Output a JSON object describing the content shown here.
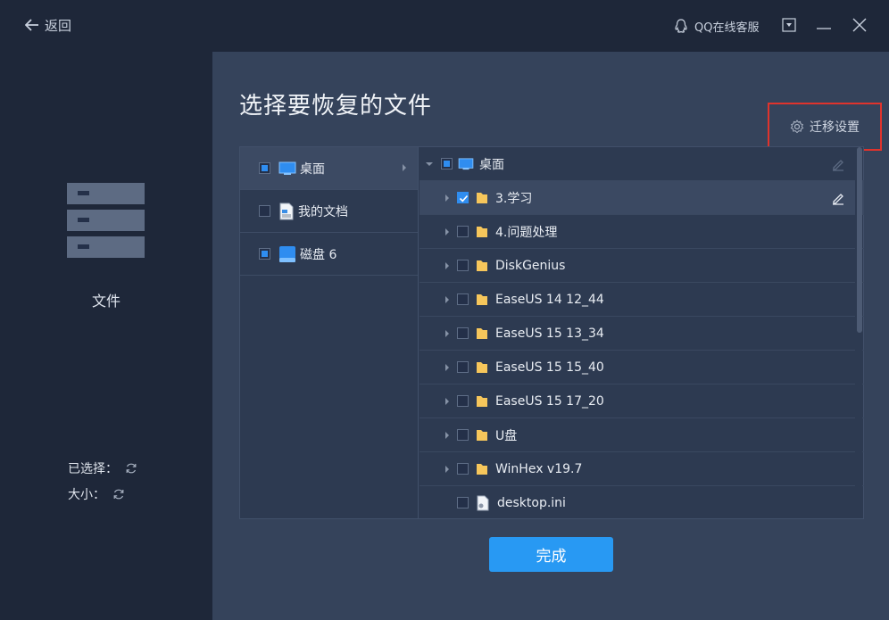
{
  "header": {
    "back_label": "返回",
    "support_label": "QQ在线客服"
  },
  "sidebar": {
    "label": "文件",
    "selected_label": "已选择：",
    "size_label": "大小："
  },
  "main": {
    "title": "选择要恢复的文件",
    "migrate_label": "迁移设置",
    "done_label": "完成"
  },
  "locations": [
    {
      "label": "桌面",
      "state": "partial",
      "icon": "desktop-icon"
    },
    {
      "label": "我的文档",
      "state": "unchecked",
      "icon": "document-icon"
    },
    {
      "label": "磁盘 6",
      "state": "partial",
      "icon": "disk-icon"
    }
  ],
  "tree": {
    "root": {
      "label": "桌面",
      "state": "partial",
      "icon": "desktop-icon"
    },
    "items": [
      {
        "label": "3.学习",
        "state": "checked",
        "icon": "folder-icon"
      },
      {
        "label": "4.问题处理",
        "state": "unchecked",
        "icon": "folder-icon"
      },
      {
        "label": "DiskGenius",
        "state": "unchecked",
        "icon": "folder-icon"
      },
      {
        "label": "EaseUS 14 12_44",
        "state": "unchecked",
        "icon": "folder-icon"
      },
      {
        "label": "EaseUS 15 13_34",
        "state": "unchecked",
        "icon": "folder-icon"
      },
      {
        "label": "EaseUS 15 15_40",
        "state": "unchecked",
        "icon": "folder-icon"
      },
      {
        "label": "EaseUS 15 17_20",
        "state": "unchecked",
        "icon": "folder-icon"
      },
      {
        "label": "U盘",
        "state": "unchecked",
        "icon": "folder-icon"
      },
      {
        "label": "WinHex v19.7",
        "state": "unchecked",
        "icon": "folder-icon"
      },
      {
        "label": "desktop.ini",
        "state": "unchecked",
        "icon": "settings-file-icon"
      }
    ]
  },
  "colors": {
    "accent": "#2899f3",
    "highlight_border": "#e0332c",
    "sidebar_bg": "#1e2739",
    "main_bg": "#35435b"
  }
}
